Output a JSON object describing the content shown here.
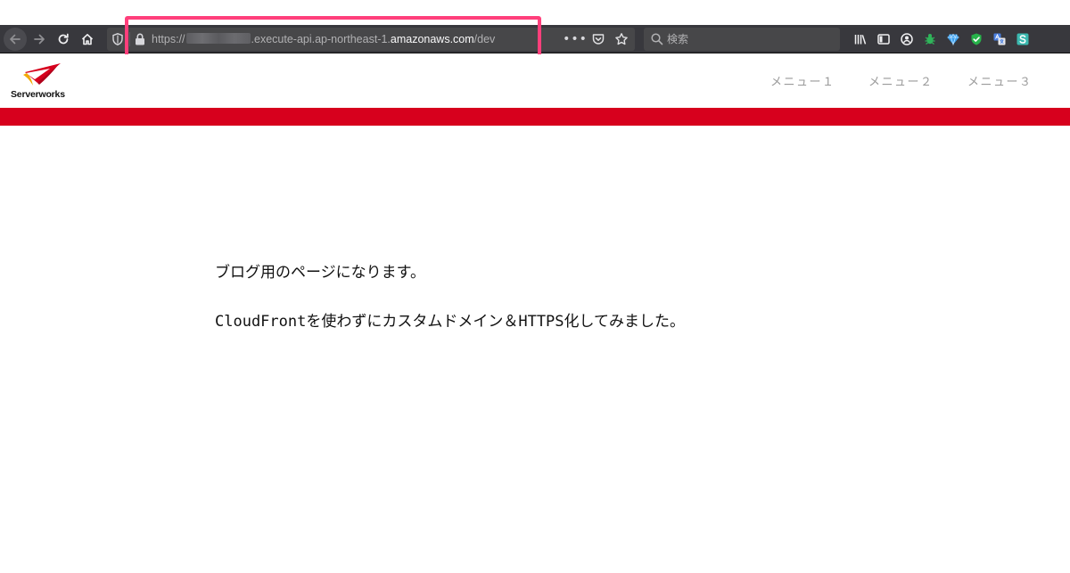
{
  "browser": {
    "url": {
      "prefix": "https://",
      "middle": ".execute-api.ap-northeast-1.",
      "domain": "amazonaws.com",
      "path": "/dev"
    },
    "more_label": "•••",
    "search": {
      "placeholder": "検索"
    },
    "icons": {
      "back": "back-arrow-icon",
      "forward": "forward-arrow-icon",
      "reload": "reload-icon",
      "home": "home-icon",
      "tracking": "shield-icon",
      "lock": "lock-icon",
      "pocket": "pocket-icon",
      "bookmark": "star-icon",
      "search": "search-icon",
      "library": "library-icon",
      "sidebar": "sidebar-icon",
      "account": "account-icon",
      "extensions": [
        "bug-extension-icon",
        "diamond-extension-icon",
        "check-shield-extension-icon",
        "translate-extension-icon",
        "s-extension-icon"
      ]
    },
    "highlight_color": "#ff3f7b"
  },
  "site": {
    "logo_text": "Serverworks",
    "nav": [
      {
        "label": "メニュー１"
      },
      {
        "label": "メニュー２"
      },
      {
        "label": "メニュー３"
      }
    ],
    "brand_color": "#d7001d"
  },
  "content": {
    "line1": "ブログ用のページになります。",
    "line2": "CloudFrontを使わずにカスタムドメイン＆HTTPS化してみました。"
  }
}
